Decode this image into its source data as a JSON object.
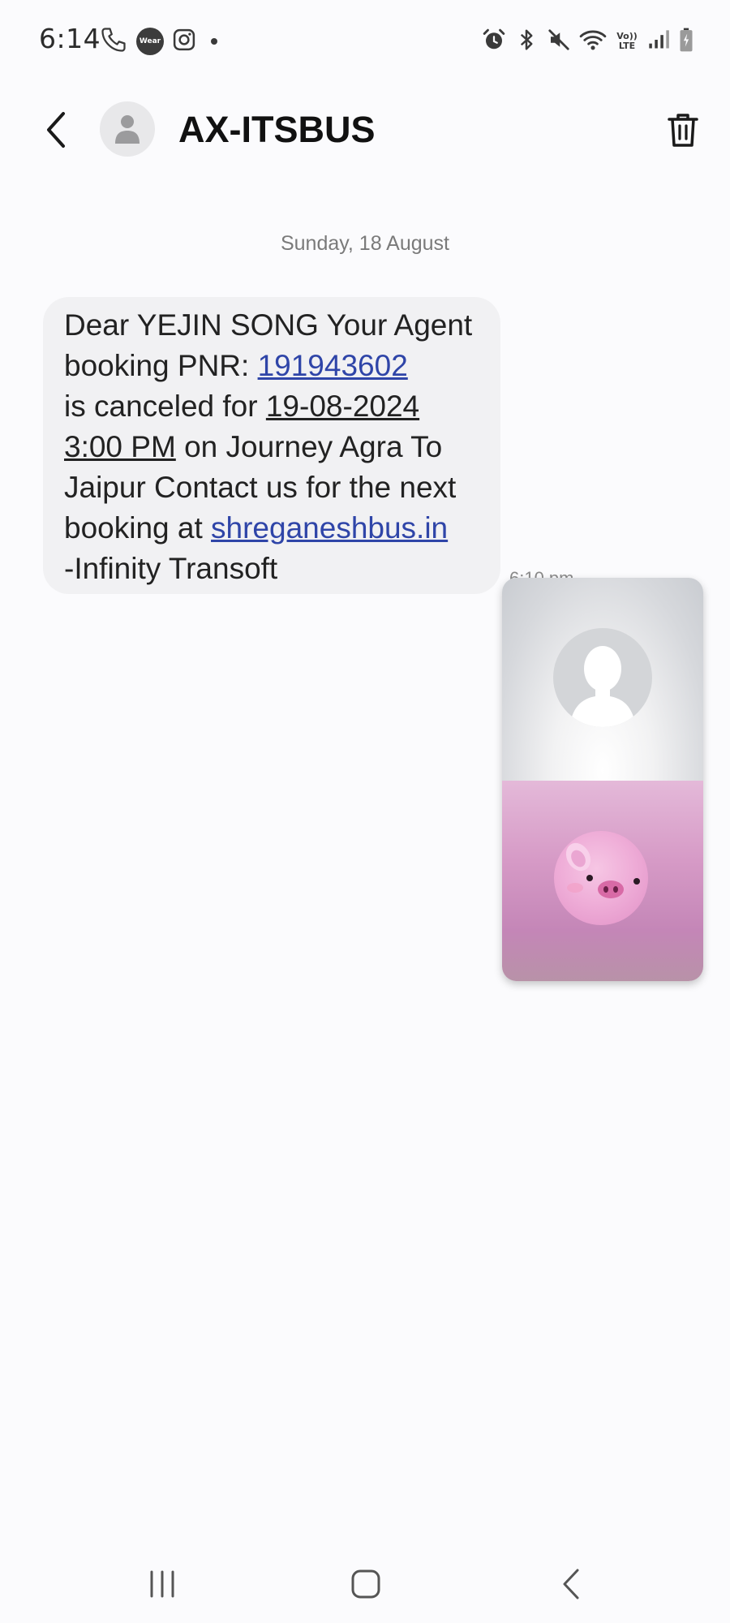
{
  "status_bar": {
    "time": "6:14",
    "wear_label": "Wear",
    "volte_label": "Vo)) LTE",
    "left_icons": [
      "phone-icon",
      "wear-icon",
      "instagram-icon",
      "notification-dot"
    ],
    "right_icons": [
      "alarm-icon",
      "bluetooth-icon",
      "mute-icon",
      "wifi-icon",
      "volte-icon",
      "signal-icon",
      "battery-icon"
    ]
  },
  "header": {
    "contact_name": "AX-ITSBUS",
    "back_icon": "chevron-left-icon",
    "delete_icon": "trash-icon"
  },
  "conversation": {
    "date_label": "Sunday, 18 August",
    "message": {
      "line1": "Dear YEJIN SONG Your Agent",
      "line2_prefix": "booking PNR: ",
      "pnr": "191943602",
      "line3_prefix": "is canceled for ",
      "date": "19-08-2024",
      "time": "3:00 PM",
      "line4_suffix": " on Journey Agra To",
      "line5": "Jaipur Contact us for the next",
      "line6_prefix": "booking at ",
      "website": "shreganeshbus.in",
      "line7": "-Infinity Transoft",
      "timestamp": "6:10 pm"
    }
  },
  "video_call": {
    "top_icon": "person-silhouette-icon",
    "bottom_icon": "pig-plush-avatar"
  },
  "navigation": {
    "icons": [
      "recents-icon",
      "home-icon",
      "back-icon"
    ]
  },
  "colors": {
    "link": "#2f45a8",
    "bubble": "#f1f1f3",
    "background": "#fbfbfd"
  }
}
